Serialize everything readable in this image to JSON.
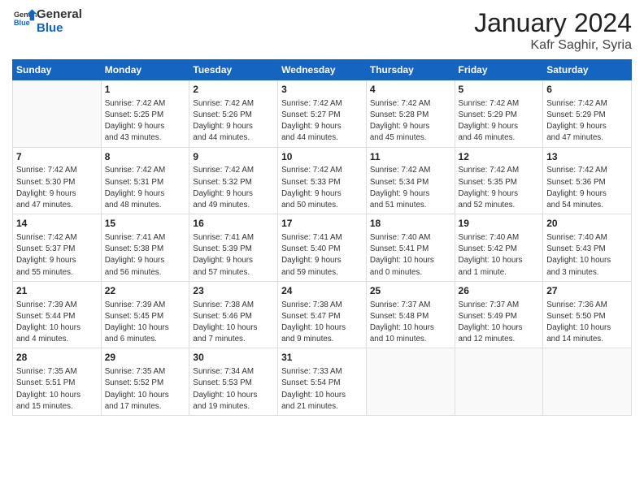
{
  "header": {
    "logo_general": "General",
    "logo_blue": "Blue",
    "month_title": "January 2024",
    "location": "Kafr Saghir, Syria"
  },
  "days_of_week": [
    "Sunday",
    "Monday",
    "Tuesday",
    "Wednesday",
    "Thursday",
    "Friday",
    "Saturday"
  ],
  "weeks": [
    [
      {
        "day": "",
        "sunrise": "",
        "sunset": "",
        "daylight": "",
        "daylight2": ""
      },
      {
        "day": "1",
        "sunrise": "Sunrise: 7:42 AM",
        "sunset": "Sunset: 5:25 PM",
        "daylight": "Daylight: 9 hours",
        "daylight2": "and 43 minutes."
      },
      {
        "day": "2",
        "sunrise": "Sunrise: 7:42 AM",
        "sunset": "Sunset: 5:26 PM",
        "daylight": "Daylight: 9 hours",
        "daylight2": "and 44 minutes."
      },
      {
        "day": "3",
        "sunrise": "Sunrise: 7:42 AM",
        "sunset": "Sunset: 5:27 PM",
        "daylight": "Daylight: 9 hours",
        "daylight2": "and 44 minutes."
      },
      {
        "day": "4",
        "sunrise": "Sunrise: 7:42 AM",
        "sunset": "Sunset: 5:28 PM",
        "daylight": "Daylight: 9 hours",
        "daylight2": "and 45 minutes."
      },
      {
        "day": "5",
        "sunrise": "Sunrise: 7:42 AM",
        "sunset": "Sunset: 5:29 PM",
        "daylight": "Daylight: 9 hours",
        "daylight2": "and 46 minutes."
      },
      {
        "day": "6",
        "sunrise": "Sunrise: 7:42 AM",
        "sunset": "Sunset: 5:29 PM",
        "daylight": "Daylight: 9 hours",
        "daylight2": "and 47 minutes."
      }
    ],
    [
      {
        "day": "7",
        "sunrise": "Sunrise: 7:42 AM",
        "sunset": "Sunset: 5:30 PM",
        "daylight": "Daylight: 9 hours",
        "daylight2": "and 47 minutes."
      },
      {
        "day": "8",
        "sunrise": "Sunrise: 7:42 AM",
        "sunset": "Sunset: 5:31 PM",
        "daylight": "Daylight: 9 hours",
        "daylight2": "and 48 minutes."
      },
      {
        "day": "9",
        "sunrise": "Sunrise: 7:42 AM",
        "sunset": "Sunset: 5:32 PM",
        "daylight": "Daylight: 9 hours",
        "daylight2": "and 49 minutes."
      },
      {
        "day": "10",
        "sunrise": "Sunrise: 7:42 AM",
        "sunset": "Sunset: 5:33 PM",
        "daylight": "Daylight: 9 hours",
        "daylight2": "and 50 minutes."
      },
      {
        "day": "11",
        "sunrise": "Sunrise: 7:42 AM",
        "sunset": "Sunset: 5:34 PM",
        "daylight": "Daylight: 9 hours",
        "daylight2": "and 51 minutes."
      },
      {
        "day": "12",
        "sunrise": "Sunrise: 7:42 AM",
        "sunset": "Sunset: 5:35 PM",
        "daylight": "Daylight: 9 hours",
        "daylight2": "and 52 minutes."
      },
      {
        "day": "13",
        "sunrise": "Sunrise: 7:42 AM",
        "sunset": "Sunset: 5:36 PM",
        "daylight": "Daylight: 9 hours",
        "daylight2": "and 54 minutes."
      }
    ],
    [
      {
        "day": "14",
        "sunrise": "Sunrise: 7:42 AM",
        "sunset": "Sunset: 5:37 PM",
        "daylight": "Daylight: 9 hours",
        "daylight2": "and 55 minutes."
      },
      {
        "day": "15",
        "sunrise": "Sunrise: 7:41 AM",
        "sunset": "Sunset: 5:38 PM",
        "daylight": "Daylight: 9 hours",
        "daylight2": "and 56 minutes."
      },
      {
        "day": "16",
        "sunrise": "Sunrise: 7:41 AM",
        "sunset": "Sunset: 5:39 PM",
        "daylight": "Daylight: 9 hours",
        "daylight2": "and 57 minutes."
      },
      {
        "day": "17",
        "sunrise": "Sunrise: 7:41 AM",
        "sunset": "Sunset: 5:40 PM",
        "daylight": "Daylight: 9 hours",
        "daylight2": "and 59 minutes."
      },
      {
        "day": "18",
        "sunrise": "Sunrise: 7:40 AM",
        "sunset": "Sunset: 5:41 PM",
        "daylight": "Daylight: 10 hours",
        "daylight2": "and 0 minutes."
      },
      {
        "day": "19",
        "sunrise": "Sunrise: 7:40 AM",
        "sunset": "Sunset: 5:42 PM",
        "daylight": "Daylight: 10 hours",
        "daylight2": "and 1 minute."
      },
      {
        "day": "20",
        "sunrise": "Sunrise: 7:40 AM",
        "sunset": "Sunset: 5:43 PM",
        "daylight": "Daylight: 10 hours",
        "daylight2": "and 3 minutes."
      }
    ],
    [
      {
        "day": "21",
        "sunrise": "Sunrise: 7:39 AM",
        "sunset": "Sunset: 5:44 PM",
        "daylight": "Daylight: 10 hours",
        "daylight2": "and 4 minutes."
      },
      {
        "day": "22",
        "sunrise": "Sunrise: 7:39 AM",
        "sunset": "Sunset: 5:45 PM",
        "daylight": "Daylight: 10 hours",
        "daylight2": "and 6 minutes."
      },
      {
        "day": "23",
        "sunrise": "Sunrise: 7:38 AM",
        "sunset": "Sunset: 5:46 PM",
        "daylight": "Daylight: 10 hours",
        "daylight2": "and 7 minutes."
      },
      {
        "day": "24",
        "sunrise": "Sunrise: 7:38 AM",
        "sunset": "Sunset: 5:47 PM",
        "daylight": "Daylight: 10 hours",
        "daylight2": "and 9 minutes."
      },
      {
        "day": "25",
        "sunrise": "Sunrise: 7:37 AM",
        "sunset": "Sunset: 5:48 PM",
        "daylight": "Daylight: 10 hours",
        "daylight2": "and 10 minutes."
      },
      {
        "day": "26",
        "sunrise": "Sunrise: 7:37 AM",
        "sunset": "Sunset: 5:49 PM",
        "daylight": "Daylight: 10 hours",
        "daylight2": "and 12 minutes."
      },
      {
        "day": "27",
        "sunrise": "Sunrise: 7:36 AM",
        "sunset": "Sunset: 5:50 PM",
        "daylight": "Daylight: 10 hours",
        "daylight2": "and 14 minutes."
      }
    ],
    [
      {
        "day": "28",
        "sunrise": "Sunrise: 7:35 AM",
        "sunset": "Sunset: 5:51 PM",
        "daylight": "Daylight: 10 hours",
        "daylight2": "and 15 minutes."
      },
      {
        "day": "29",
        "sunrise": "Sunrise: 7:35 AM",
        "sunset": "Sunset: 5:52 PM",
        "daylight": "Daylight: 10 hours",
        "daylight2": "and 17 minutes."
      },
      {
        "day": "30",
        "sunrise": "Sunrise: 7:34 AM",
        "sunset": "Sunset: 5:53 PM",
        "daylight": "Daylight: 10 hours",
        "daylight2": "and 19 minutes."
      },
      {
        "day": "31",
        "sunrise": "Sunrise: 7:33 AM",
        "sunset": "Sunset: 5:54 PM",
        "daylight": "Daylight: 10 hours",
        "daylight2": "and 21 minutes."
      },
      {
        "day": "",
        "sunrise": "",
        "sunset": "",
        "daylight": "",
        "daylight2": ""
      },
      {
        "day": "",
        "sunrise": "",
        "sunset": "",
        "daylight": "",
        "daylight2": ""
      },
      {
        "day": "",
        "sunrise": "",
        "sunset": "",
        "daylight": "",
        "daylight2": ""
      }
    ]
  ]
}
